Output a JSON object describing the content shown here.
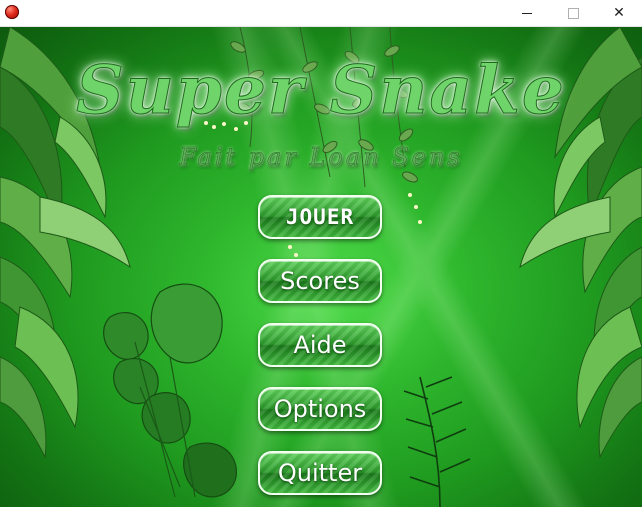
{
  "window": {
    "icon": "red-ball-icon",
    "controls": {
      "minimize": "minimize-icon",
      "maximize": "maximize-icon",
      "close": "close-icon",
      "close_glyph": "✕"
    }
  },
  "logo": {
    "title": "Super Snake",
    "subtitle": "Fait par Loan Sens"
  },
  "menu": {
    "buttons": [
      {
        "label": "JOUER"
      },
      {
        "label": "Scores"
      },
      {
        "label": "Aide"
      },
      {
        "label": "Options"
      },
      {
        "label": "Quitter"
      }
    ]
  },
  "colors": {
    "background": "#2fb72e",
    "button": "#2d9b2b",
    "button_border": "#f2fff0",
    "title_glow": "#eaffea"
  }
}
